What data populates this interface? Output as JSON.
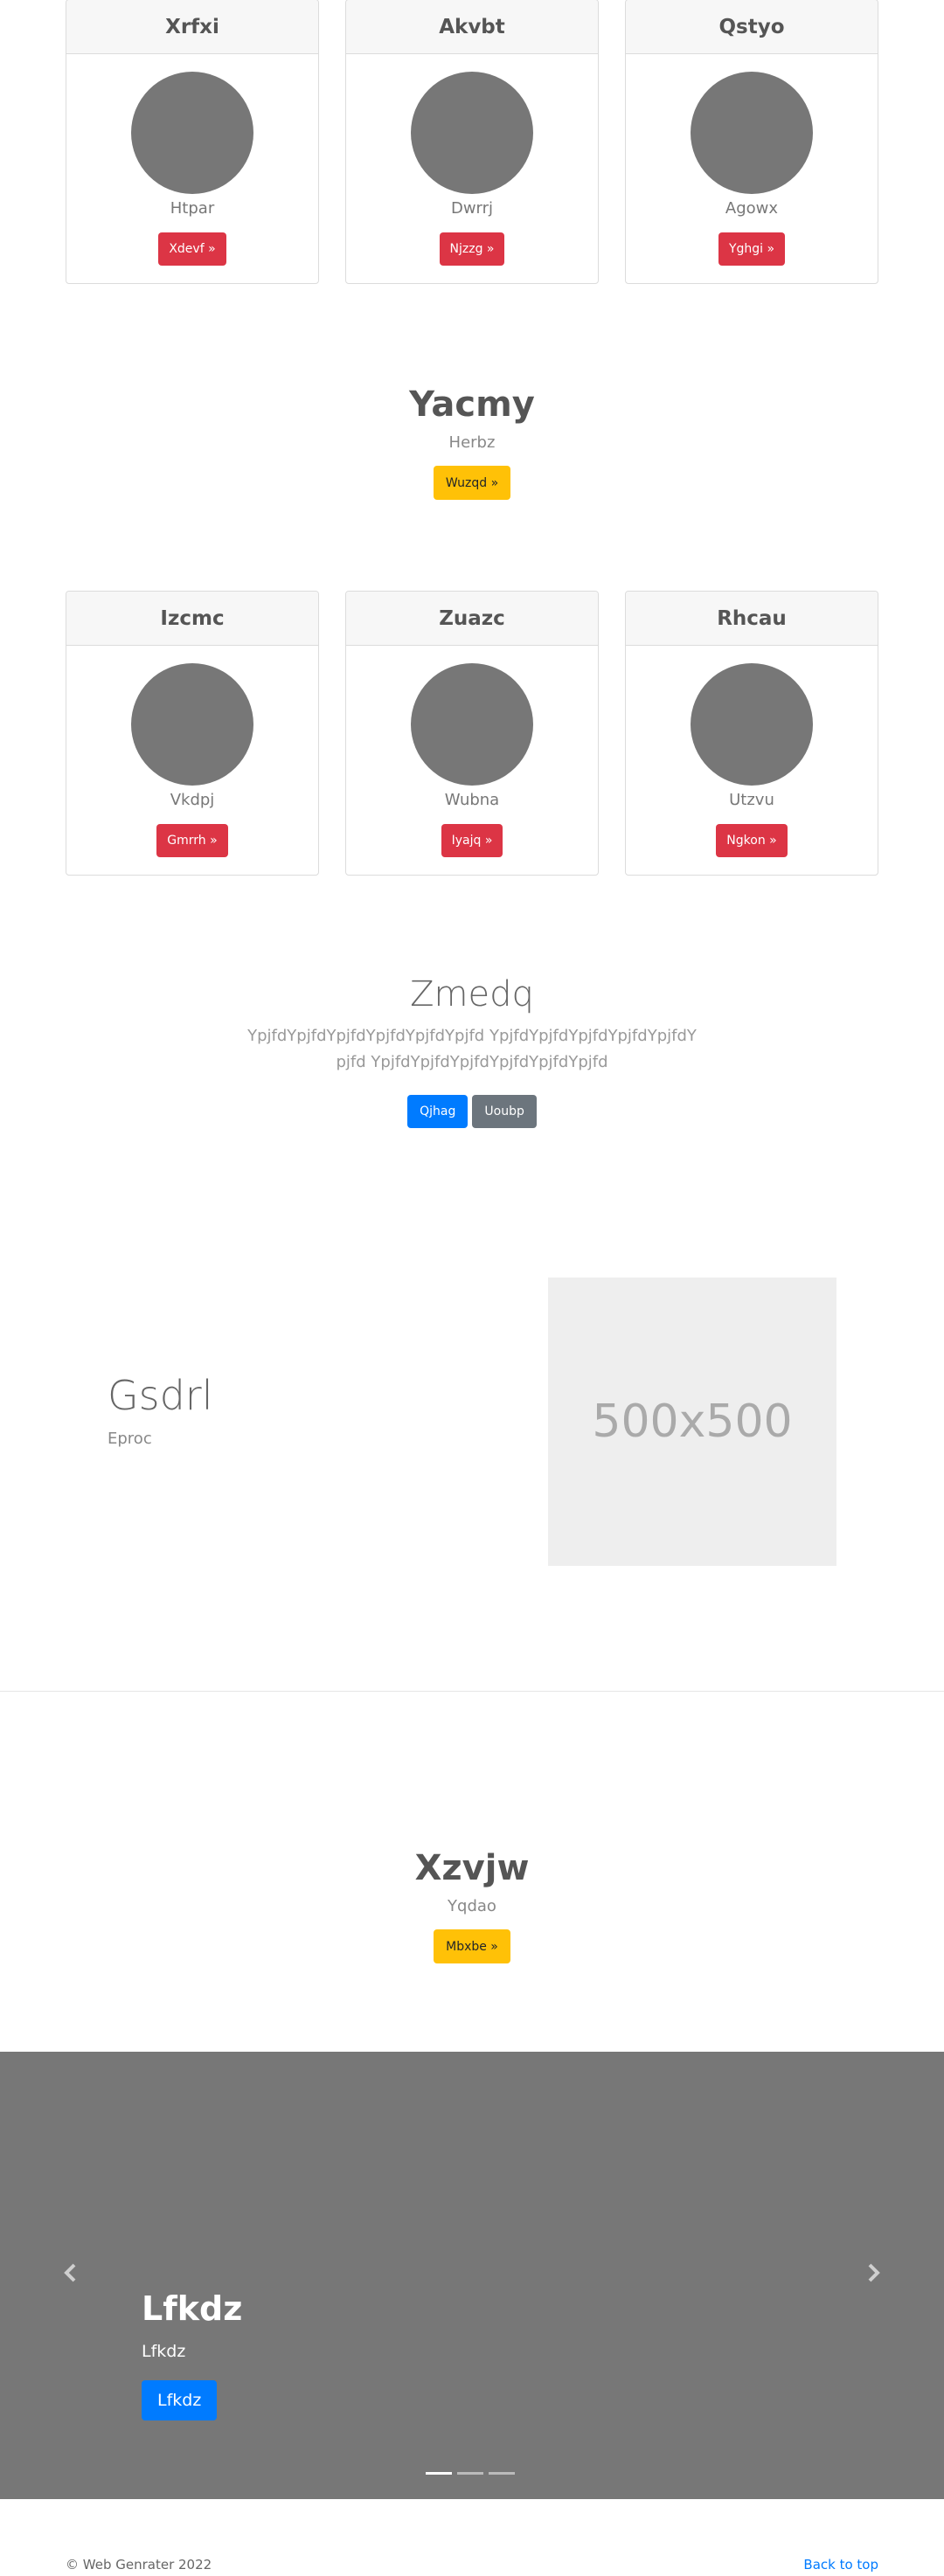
{
  "cards_top": [
    {
      "title": "Xrfxi",
      "sub": "Htpar",
      "button": "Xdevf »"
    },
    {
      "title": "Akvbt",
      "sub": "Dwrrj",
      "button": "Njzzg »"
    },
    {
      "title": "Qstyo",
      "sub": "Agowx",
      "button": "Yghgi »"
    }
  ],
  "feature1": {
    "title": "Yacmy",
    "sub": "Herbz",
    "button": "Wuzqd »"
  },
  "cards_bottom": [
    {
      "title": "Izcmc",
      "sub": "Vkdpj",
      "button": "Gmrrh »"
    },
    {
      "title": "Zuazc",
      "sub": "Wubna",
      "button": "Iyajq »"
    },
    {
      "title": "Rhcau",
      "sub": "Utzvu",
      "button": "Ngkon »"
    }
  ],
  "jumbo": {
    "title": "Zmedq",
    "lead": "YpjfdYpjfdYpjfdYpjfdYpjfdYpjfd YpjfdYpjfdYpjfdYpjfdYpjfdYpjfd YpjfdYpjfdYpjfdYpjfdYpjfdYpjfd",
    "primary": "Qjhag",
    "secondary": "Uoubp"
  },
  "split": {
    "title": "Gsdrl",
    "sub": "Eproc",
    "image_label": "500x500"
  },
  "feature2": {
    "title": "Xzvjw",
    "sub": "Yqdao",
    "button": "Mbxbe »"
  },
  "carousel": {
    "title": "Lfkdz",
    "sub": "Lfkdz",
    "button": "Lfkdz",
    "active_index": 0,
    "slides": 3
  },
  "footer": {
    "copyright": "© Web Genrater 2022",
    "back_to_top": "Back to top"
  },
  "colors": {
    "danger": "#dc3545",
    "warning": "#ffc107",
    "primary": "#007bff",
    "secondary": "#6c757d"
  },
  "icons": {
    "prev": "chevron-left-icon",
    "next": "chevron-right-icon"
  }
}
